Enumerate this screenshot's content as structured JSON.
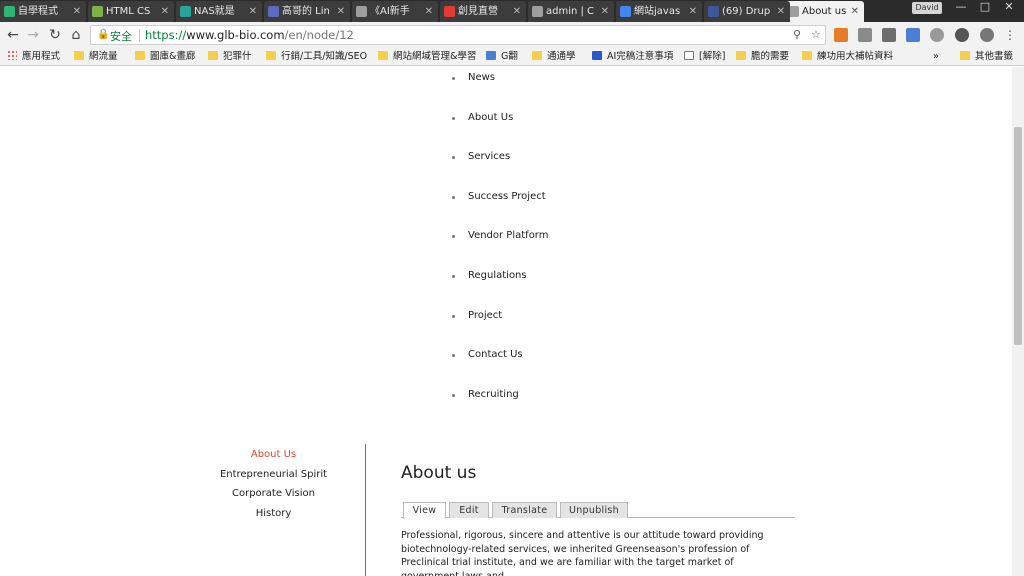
{
  "tabs": [
    {
      "title": "自學程式",
      "color": "#2bb673"
    },
    {
      "title": "HTML CS",
      "color": "#7cb342"
    },
    {
      "title": "NAS就是",
      "color": "#26a69a"
    },
    {
      "title": "高哥的 Lin",
      "color": "#5c6bc0"
    },
    {
      "title": "《AI新手",
      "color": "#9e9e9e"
    },
    {
      "title": "創見直營",
      "color": "#e53935"
    },
    {
      "title": "admin | C",
      "color": "#9e9e9e"
    },
    {
      "title": "網站javas",
      "color": "#4285f4"
    },
    {
      "title": "(69) Drup",
      "color": "#3b5998"
    },
    {
      "title": "About us",
      "color": "#9e9e9e"
    }
  ],
  "window": {
    "profile": "David",
    "minimize": "—",
    "maximize": "□",
    "close": "✕"
  },
  "address": {
    "secure_label": "安全",
    "url_scheme": "https://",
    "url_host": "www.glb-bio.com",
    "url_path": "/en/node/12"
  },
  "bookmarks": [
    {
      "label": "應用程式",
      "icon": "apps-icon"
    },
    {
      "label": "網流量",
      "icon": "folder-icon"
    },
    {
      "label": "圖庫&畫廊",
      "icon": "folder-icon"
    },
    {
      "label": "犯罪什",
      "icon": "folder-icon"
    },
    {
      "label": "行銷/工具/知識/SEO",
      "icon": "folder-icon"
    },
    {
      "label": "網站網域管理&學習",
      "icon": "folder-icon"
    },
    {
      "label": "G翻",
      "icon": "translate-icon"
    },
    {
      "label": "通通學",
      "icon": "folder-icon"
    },
    {
      "label": "AI完稿注意事項",
      "icon": "bookmark-icon"
    },
    {
      "label": "[解除]",
      "icon": "page-icon"
    },
    {
      "label": "膽的需要",
      "icon": "folder-icon"
    },
    {
      "label": "練功用大補帖資料",
      "icon": "folder-icon"
    },
    {
      "label": "其他書籤",
      "icon": "folder-icon"
    }
  ],
  "main_menu": [
    "News",
    "About Us",
    "Services",
    "Success Project",
    "Vendor Platform",
    "Regulations",
    "Project",
    "Contact Us",
    "Recruiting"
  ],
  "sidebar": {
    "items": [
      "About Us",
      "Entrepreneurial Spirit",
      "Corporate Vision",
      "History"
    ],
    "active_index": 0,
    "active_color": "#d9452c"
  },
  "content": {
    "title": "About us",
    "tabs": [
      "View",
      "Edit",
      "Translate",
      "Unpublish"
    ],
    "active_tab": 0,
    "paragraph": "Professional, rigorous, sincere and attentive is our attitude toward providing biotechnology-related services, we inherited Greenseason's profession of Preclinical trial institute, and we are familiar with the target market of government laws and"
  },
  "colors": {
    "divider": "#3c7f9e",
    "secure": "#0b8043"
  }
}
